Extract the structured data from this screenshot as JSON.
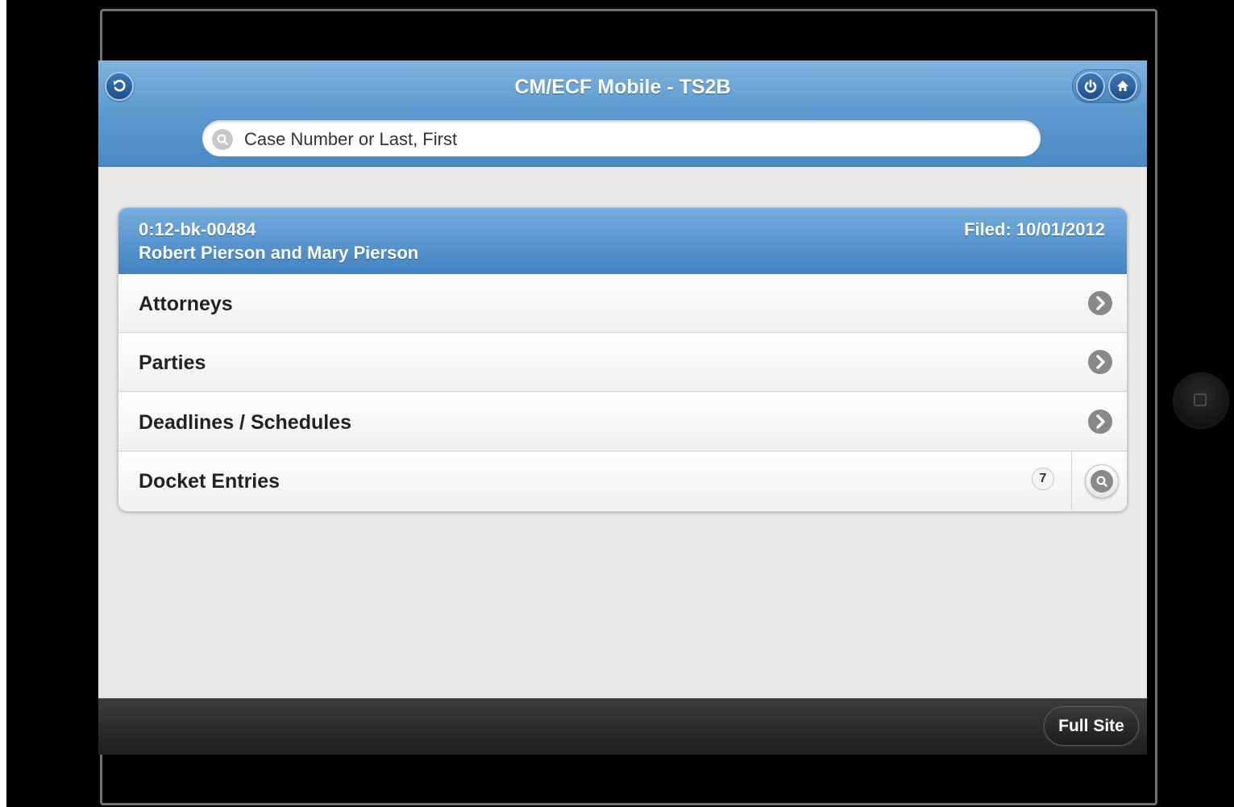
{
  "header": {
    "title": "CM/ECF Mobile - TS2B",
    "back_icon": "back-arrow-icon",
    "power_icon": "power-icon",
    "home_icon": "home-icon"
  },
  "search": {
    "placeholder": "Case Number or Last, First",
    "icon": "search-icon"
  },
  "case": {
    "number": "0:12-bk-00484",
    "parties": "Robert Pierson and Mary Pierson",
    "filed": "Filed: 10/01/2012"
  },
  "menu": {
    "items": [
      {
        "label": "Attorneys",
        "icon": "chevron-right-icon"
      },
      {
        "label": "Parties",
        "icon": "chevron-right-icon"
      },
      {
        "label": "Deadlines / Schedules",
        "icon": "chevron-right-icon"
      },
      {
        "label": "Docket Entries",
        "count": "7",
        "icon": "search-icon"
      }
    ]
  },
  "footer": {
    "full_site_label": "Full Site"
  },
  "colors": {
    "header_blue": "#5f9cd0",
    "footer_dark": "#1e1e1e",
    "background": "#e8e8e8"
  }
}
